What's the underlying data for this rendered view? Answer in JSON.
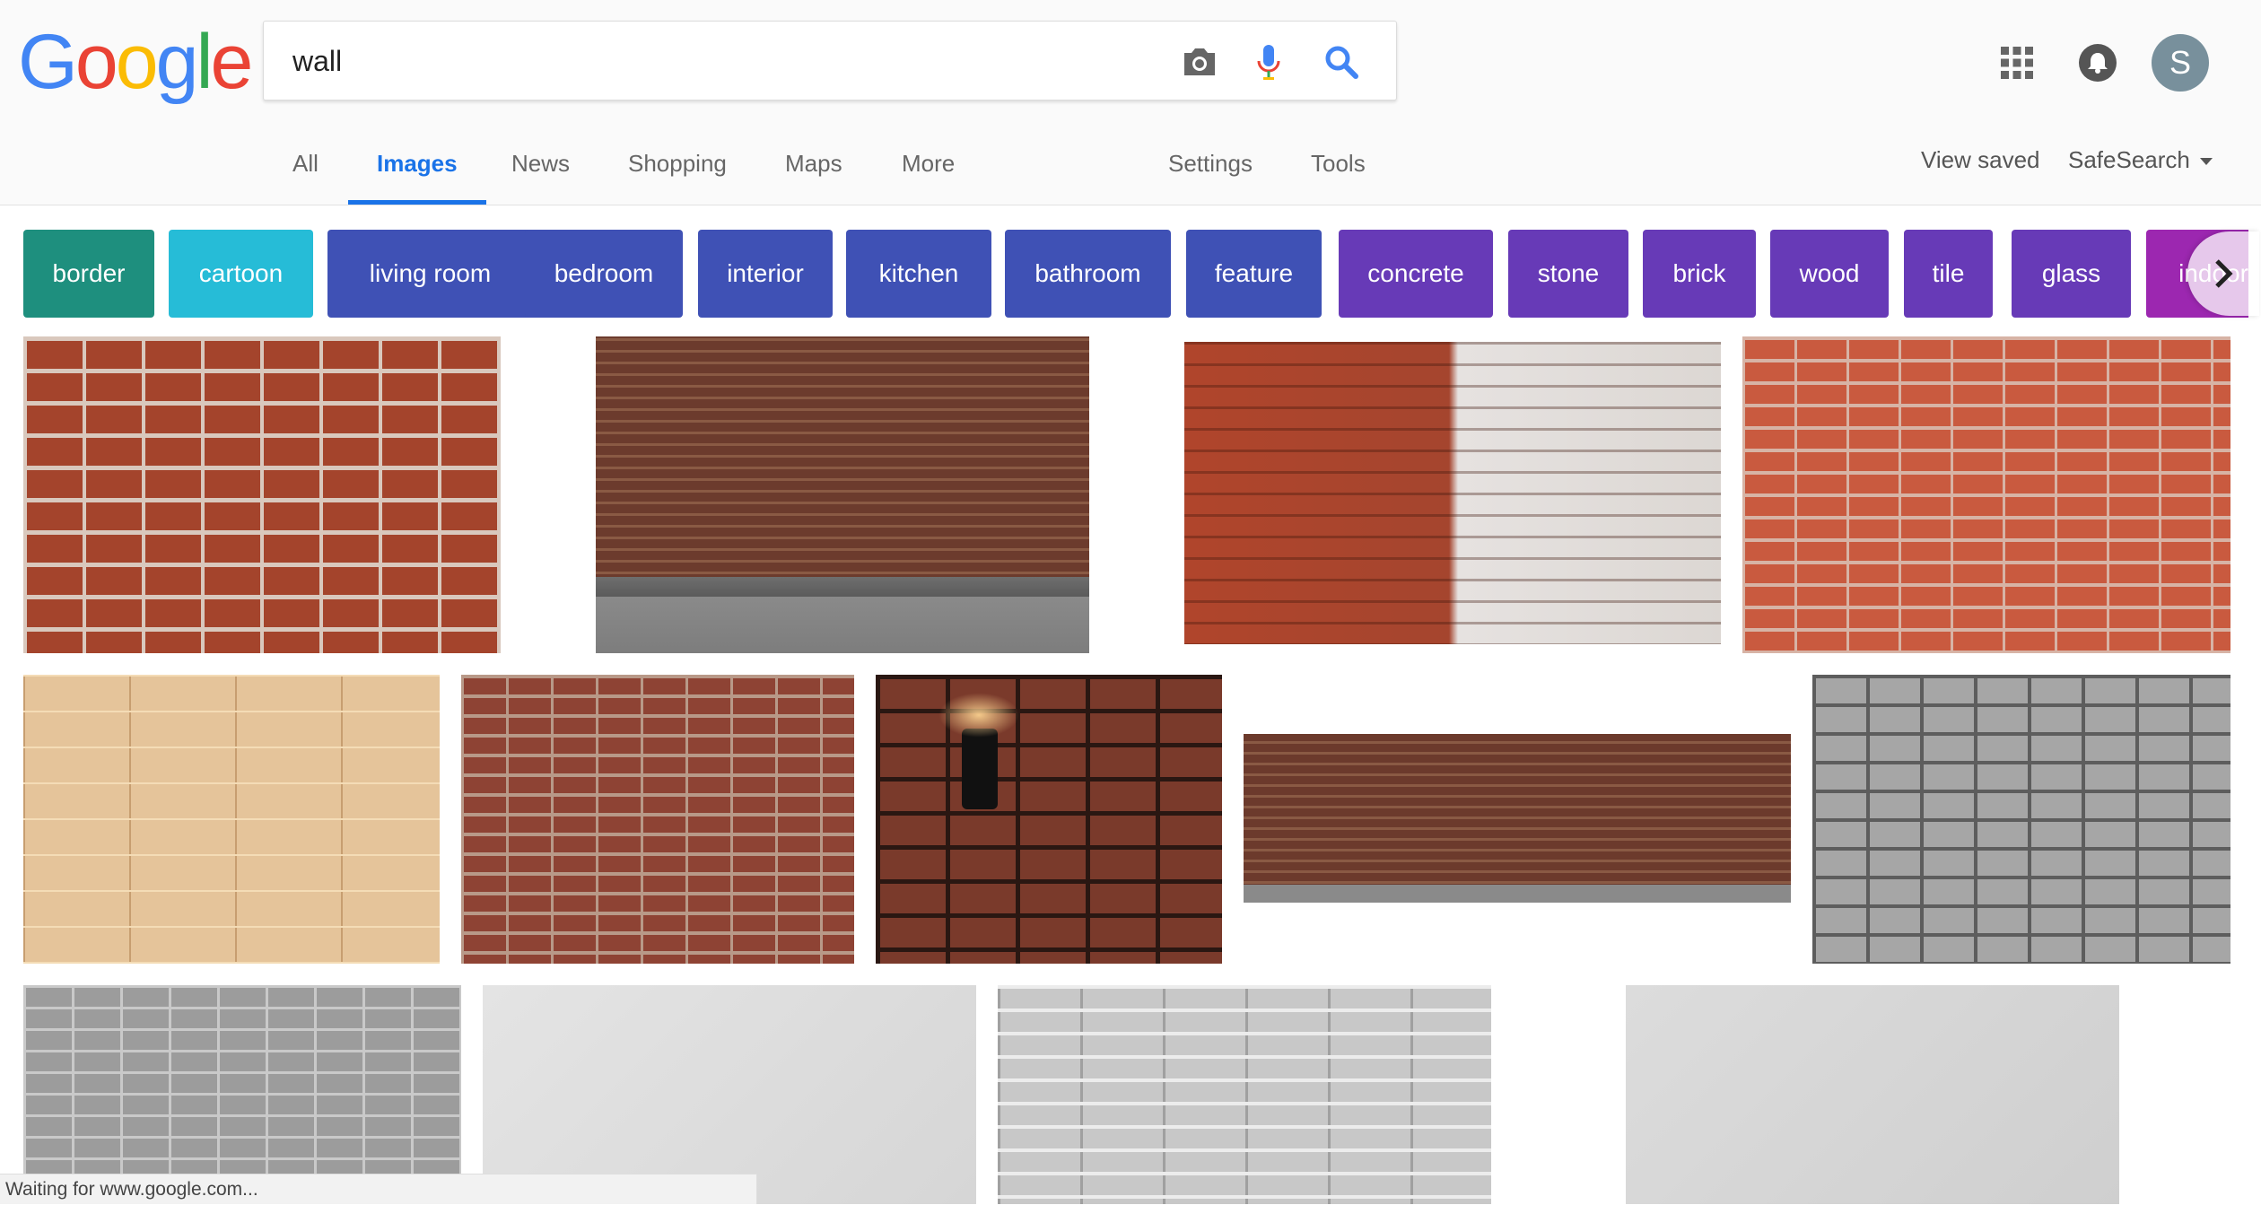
{
  "search": {
    "query": "wall"
  },
  "tabs": [
    "All",
    "Images",
    "News",
    "Shopping",
    "Maps",
    "More"
  ],
  "settings": {
    "settings_label": "Settings",
    "tools_label": "Tools"
  },
  "right_links": {
    "view_saved": "View saved",
    "safesearch": "SafeSearch"
  },
  "avatar": {
    "initial": "S"
  },
  "chips": [
    {
      "label": "border",
      "color": "#1e8f7e"
    },
    {
      "label": "cartoon",
      "color": "#26bcd7"
    },
    {
      "label": "living room",
      "color": "#3f51b5"
    },
    {
      "label": "bedroom",
      "color": "#3f51b5"
    },
    {
      "label": "interior",
      "color": "#3f51b5"
    },
    {
      "label": "kitchen",
      "color": "#3f51b5"
    },
    {
      "label": "bathroom",
      "color": "#3f51b5"
    },
    {
      "label": "feature",
      "color": "#3f51b5"
    },
    {
      "label": "concrete",
      "color": "#673ab7"
    },
    {
      "label": "stone",
      "color": "#673ab7"
    },
    {
      "label": "brick",
      "color": "#673ab7"
    },
    {
      "label": "wood",
      "color": "#673ab7"
    },
    {
      "label": "tile",
      "color": "#673ab7"
    },
    {
      "label": "glass",
      "color": "#673ab7"
    },
    {
      "label": "indoor",
      "color": "#9c27b0"
    }
  ],
  "status": {
    "text": "Waiting for www.google.com..."
  },
  "colors": {
    "accent": "#1a73e8"
  }
}
